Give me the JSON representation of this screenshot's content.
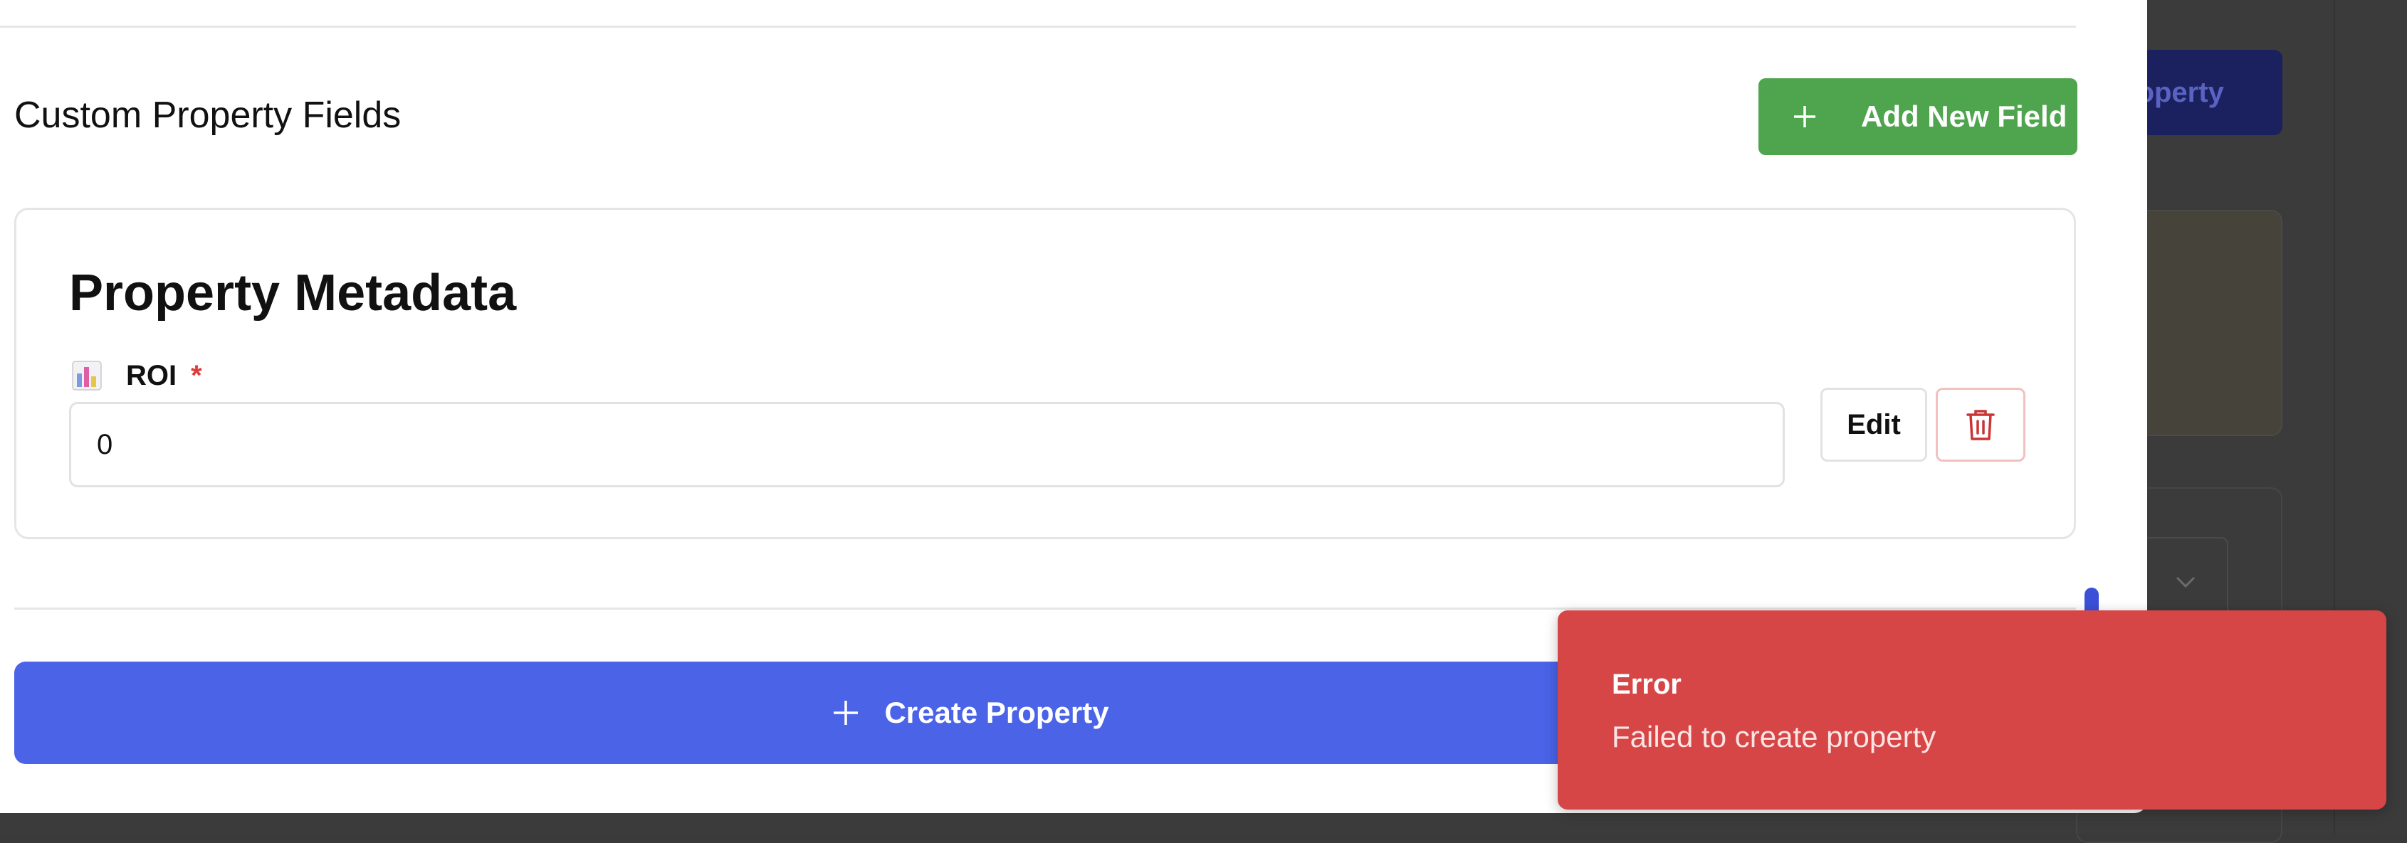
{
  "background": {
    "create_button_label": "roperty"
  },
  "modal": {
    "section_title": "Custom Property Fields",
    "add_field_button": {
      "label": "Add New Field",
      "icon": "plus-icon"
    },
    "metadata_card": {
      "title": "Property Metadata",
      "field": {
        "icon": "bar-chart-icon",
        "label": "ROI",
        "required_marker": "*",
        "value": "0"
      },
      "edit_button_label": "Edit",
      "delete_button_icon": "trash-icon"
    },
    "create_button": {
      "label": "Create Property",
      "icon": "plus-icon"
    }
  },
  "toast": {
    "title": "Error",
    "message": "Failed to create property"
  },
  "colors": {
    "add_button": "#4fa44e",
    "create_button": "#4a63e7",
    "toast_error": "#d64646",
    "required": "#e03b3b",
    "delete_icon": "#c93535"
  }
}
